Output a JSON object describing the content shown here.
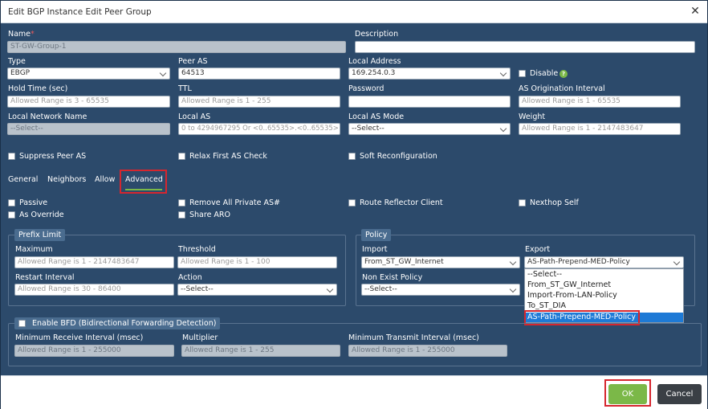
{
  "dialog": {
    "title": "Edit BGP Instance Edit Peer Group",
    "close_glyph": "✕"
  },
  "fields": {
    "name": {
      "label": "Name",
      "required_mark": "*",
      "value": "ST-GW-Group-1"
    },
    "description": {
      "label": "Description",
      "value": ""
    },
    "type": {
      "label": "Type",
      "value": "EBGP"
    },
    "peer_as": {
      "label": "Peer AS",
      "value": "64513"
    },
    "local_address": {
      "label": "Local Address",
      "value": "169.254.0.3"
    },
    "disable": {
      "label": "Disable",
      "help_glyph": "?"
    },
    "hold_time": {
      "label": "Hold Time (sec)",
      "placeholder": "Allowed Range is 3 - 65535"
    },
    "ttl": {
      "label": "TTL",
      "placeholder": "Allowed Range is 1 - 255"
    },
    "password": {
      "label": "Password",
      "value": ""
    },
    "as_origination_interval": {
      "label": "AS Origination Interval",
      "placeholder": "Allowed Range is 1 - 65535"
    },
    "local_network_name": {
      "label": "Local Network Name",
      "value": "--Select--"
    },
    "local_as": {
      "label": "Local AS",
      "placeholder": "0 to 4294967295 Or <0..65535>.<0..65535>"
    },
    "local_as_mode": {
      "label": "Local AS Mode",
      "value": "--Select--"
    },
    "weight": {
      "label": "Weight",
      "placeholder": "Allowed Range is 1 - 2147483647"
    }
  },
  "checkboxes": {
    "suppress_peer_as": "Suppress Peer AS",
    "relax_first_as_check": "Relax First AS Check",
    "soft_reconfiguration": "Soft Reconfiguration"
  },
  "tabs": [
    "General",
    "Neighbors",
    "Allow",
    "Advanced"
  ],
  "advanced": {
    "passive": "Passive",
    "remove_all_private_as": "Remove All Private AS#",
    "route_reflector_client": "Route Reflector Client",
    "nexthop_self": "Nexthop Self",
    "as_override": "As Override",
    "share_aro": "Share ARO"
  },
  "prefix_limit": {
    "legend": "Prefix Limit",
    "maximum": {
      "label": "Maximum",
      "placeholder": "Allowed Range is 1 - 2147483647"
    },
    "threshold": {
      "label": "Threshold",
      "placeholder": "Allowed Range is 1 - 100"
    },
    "restart_interval": {
      "label": "Restart Interval",
      "placeholder": "Allowed Range is 30 - 86400"
    },
    "action": {
      "label": "Action",
      "value": "--Select--"
    }
  },
  "policy": {
    "legend": "Policy",
    "import": {
      "label": "Import",
      "value": "From_ST_GW_Internet"
    },
    "export": {
      "label": "Export",
      "value": "AS-Path-Prepend-MED-Policy"
    },
    "non_exist_policy": {
      "label": "Non Exist Policy",
      "value": "--Select--"
    },
    "export_options": [
      "--Select--",
      "From_ST_GW_Internet",
      "Import-From-LAN-Policy",
      "To_ST_DIA",
      "AS-Path-Prepend-MED-Policy"
    ]
  },
  "bfd": {
    "legend": "Enable BFD (Bidirectional Forwarding Detection)",
    "min_receive": {
      "label": "Minimum Receive Interval (msec)",
      "placeholder": "Allowed Range is 1 - 255000"
    },
    "multiplier": {
      "label": "Multiplier",
      "placeholder": "Allowed Range is 1 - 255"
    },
    "min_transmit": {
      "label": "Minimum Transmit Interval (msec)",
      "placeholder": "Allowed Range is 1 - 255000"
    }
  },
  "footer": {
    "ok": "OK",
    "cancel": "Cancel"
  },
  "colors": {
    "panel": "#2c4a6b",
    "accent": "#7bb848",
    "highlight": "#d6262e",
    "selection": "#1e7ad6"
  }
}
